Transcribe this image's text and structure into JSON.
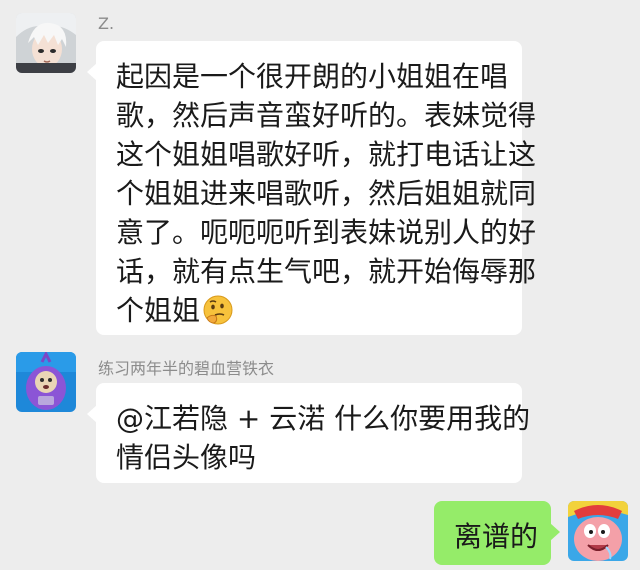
{
  "messages": [
    {
      "sender": "Z.",
      "avatar_icon": "anime-white-hair-avatar-icon",
      "lines": [
        "起因是一个很开朗的小姐姐在唱",
        "歌，然后声音蛮好听的。表妹觉得",
        "这个姐姐唱歌好听，就打电话让这",
        "个姐姐进来唱歌听，然后姐姐就同",
        "意了。呃呃呃听到表妹说别人的好",
        "话，就有点生气吧，就开始侮辱那",
        "个姐姐"
      ],
      "trailing_emoji": "thinking-face-emoji"
    },
    {
      "sender": "练习两年半的碧血营铁衣",
      "avatar_icon": "purple-teletubby-avatar-icon",
      "lines": [
        "@江若隐 + 云渃   什么你要用我的",
        "情侣头像吗"
      ]
    },
    {
      "sender": "",
      "avatar_icon": "patrick-star-avatar-icon",
      "lines": [
        "离谱的"
      ],
      "outgoing": true
    }
  ],
  "colors": {
    "background": "#ededed",
    "incoming_bubble": "#ffffff",
    "outgoing_bubble": "#95ec69",
    "name_text": "#8c8c8c"
  }
}
